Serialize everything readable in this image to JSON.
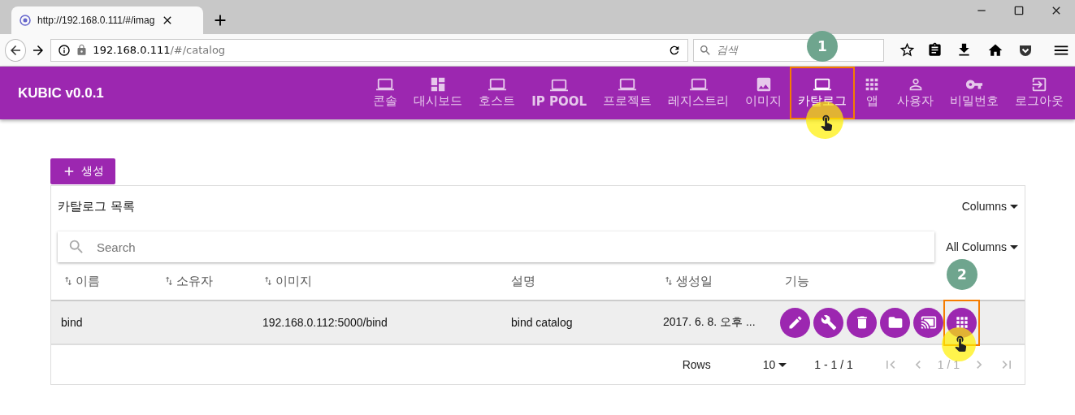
{
  "browser": {
    "tab": {
      "title": "http://192.168.0.111/#/imag",
      "selected": true
    },
    "url_host": "192.168.0.111",
    "url_path": "/#/catalog",
    "search": {
      "placeholder": "검색"
    }
  },
  "app": {
    "brand": "KUBIC v0.0.1",
    "nav": [
      {
        "label": "콘솔",
        "selected": false,
        "bold": false
      },
      {
        "label": "대시보드",
        "selected": false,
        "bold": false
      },
      {
        "label": "호스트",
        "selected": false,
        "bold": false
      },
      {
        "label": "IP POOL",
        "selected": false,
        "bold": true
      },
      {
        "label": "프로젝트",
        "selected": false,
        "bold": false
      },
      {
        "label": "레지스트리",
        "selected": false,
        "bold": false
      },
      {
        "label": "이미지",
        "selected": false,
        "bold": false
      },
      {
        "label": "카탈로그",
        "selected": true,
        "bold": false,
        "annotation": "1"
      },
      {
        "label": "앱",
        "selected": false,
        "bold": false
      },
      {
        "label": "사용자",
        "selected": false,
        "bold": false
      },
      {
        "label": "비밀번호",
        "selected": false,
        "bold": false
      },
      {
        "label": "로그아웃",
        "selected": false,
        "bold": false
      }
    ]
  },
  "create_button": {
    "label": "생성"
  },
  "table": {
    "title": "카탈로그 목록",
    "columns_menu": "Columns",
    "search": {
      "placeholder": "Search"
    },
    "column_filter": "All Columns",
    "columns": [
      {
        "label": "이름",
        "sortable": true
      },
      {
        "label": "소유자",
        "sortable": true
      },
      {
        "label": "이미지",
        "sortable": true
      },
      {
        "label": "설명",
        "sortable": false
      },
      {
        "label": "생성일",
        "sortable": true
      },
      {
        "label": "기능",
        "sortable": false
      }
    ],
    "rows": [
      {
        "cells": [
          "bind",
          "",
          "192.168.0.112:5000/bind",
          "bind catalog",
          "2017. 6. 8. 오후 ..."
        ],
        "action_annotation": "2"
      }
    ],
    "footer": {
      "rows_label": "Rows",
      "rows_per_page": "10",
      "range": "1 - 1 / 1",
      "page": "1 / 1"
    }
  }
}
